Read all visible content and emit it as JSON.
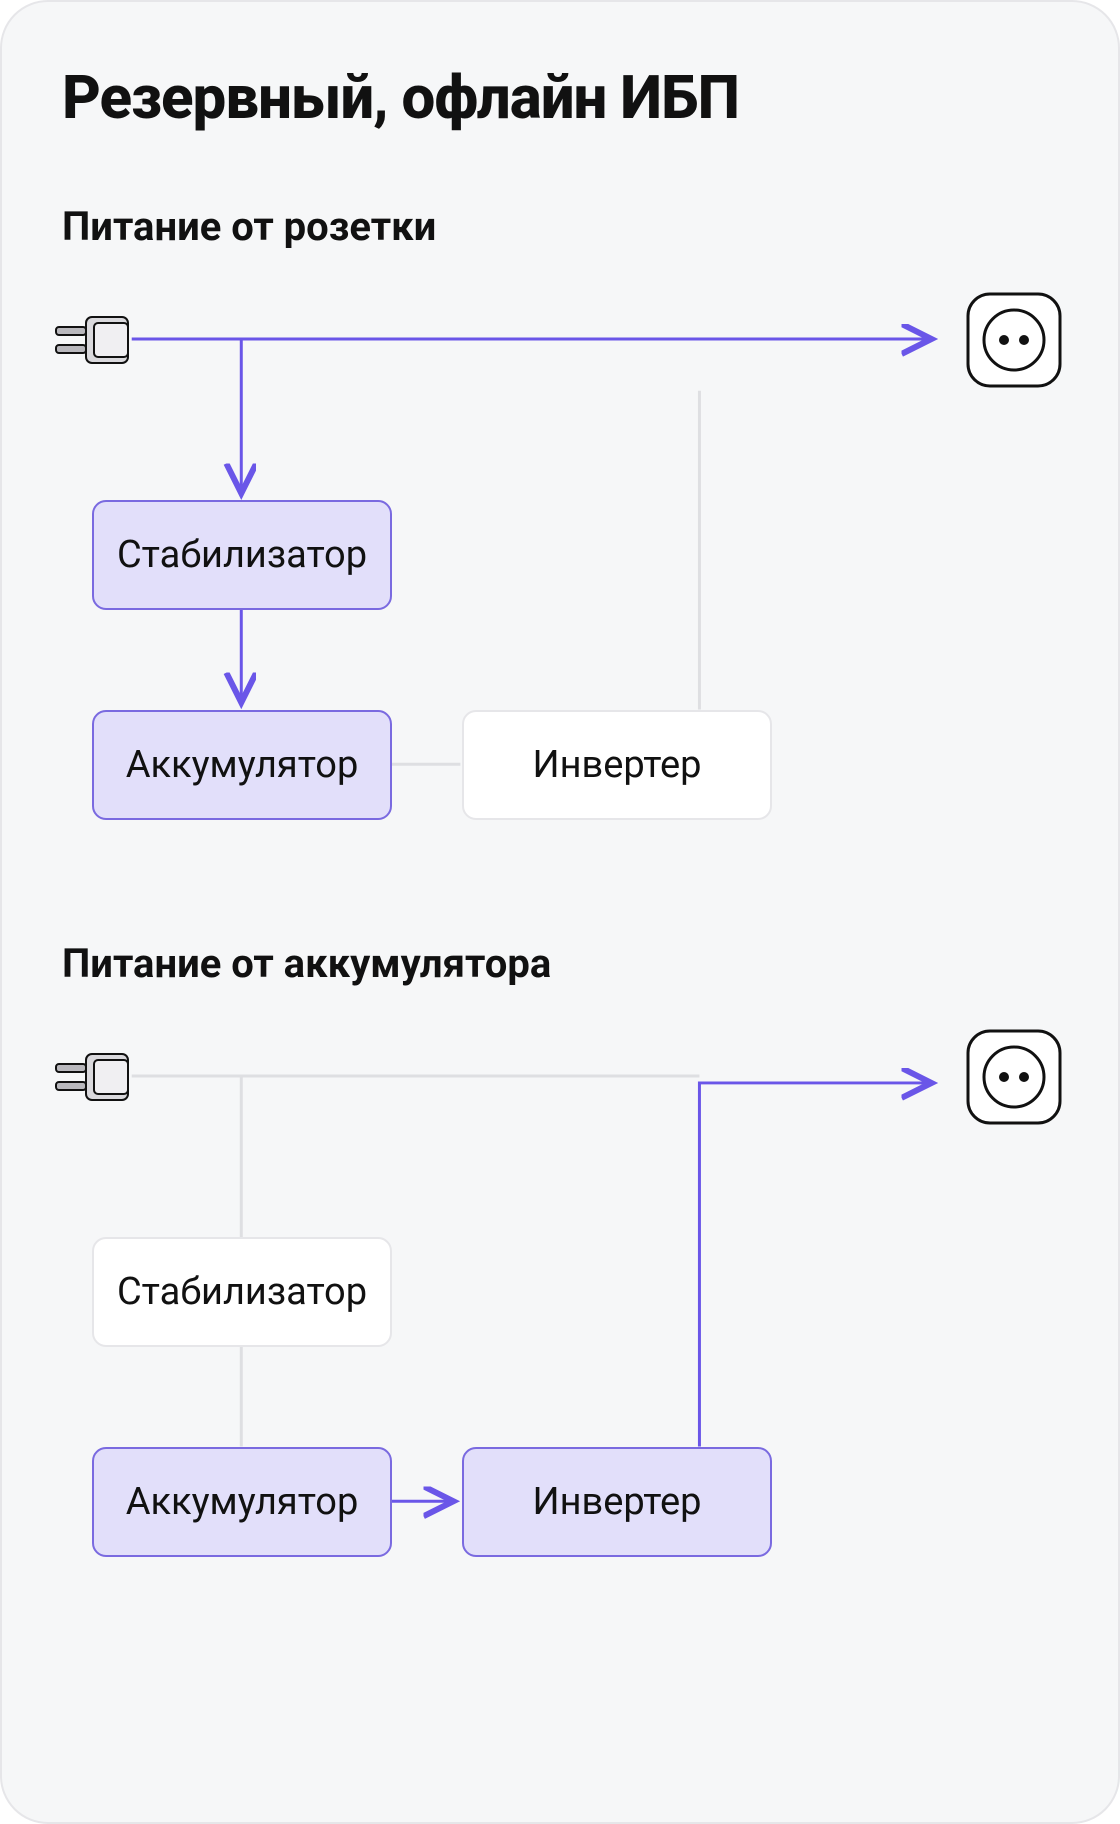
{
  "title": "Резервный, офлайн ИБП",
  "section1": {
    "subtitle": "Питание от розетки",
    "stabilizer": "Стабилизатор",
    "battery": "Аккумулятор",
    "inverter": "Инвертер"
  },
  "section2": {
    "subtitle": "Питание от аккумулятора",
    "stabilizer": "Стабилизатор",
    "battery": "Аккумулятор",
    "inverter": "Инвертер"
  },
  "colors": {
    "active_line": "#6a56e8",
    "inactive_line": "#dedfe2",
    "active_fill": "#e2dffa",
    "active_border": "#7a6ae0",
    "inactive_border": "#e6e6e9"
  }
}
